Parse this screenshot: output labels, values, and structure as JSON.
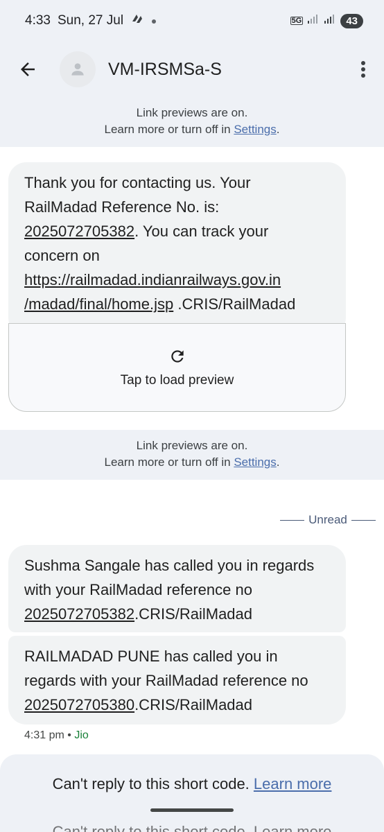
{
  "status_bar": {
    "time": "4:33",
    "date": "Sun, 27 Jul",
    "network": "5G",
    "battery": "43"
  },
  "header": {
    "contact_name": "VM-IRSMSa-S"
  },
  "link_notice": {
    "line1": "Link previews are on.",
    "line2_prefix": "Learn more or turn off in ",
    "settings_link": "Settings",
    "line2_suffix": "."
  },
  "messages": [
    {
      "text_1": "Thank you for contacting us. Your",
      "text_2": "RailMadad Reference No. is:",
      "ref_no": "2025072705382",
      "text_3": ". You can track your",
      "text_4": "concern on",
      "url_1": "https://railmadad.indianrailways.gov.in",
      "url_2": "/madad/final/home.jsp",
      "text_5": " .CRIS/RailMadad"
    },
    {
      "text_1": "Sushma Sangale has called you in regards",
      "text_2": "with your RailMadad reference no",
      "ref_no": "2025072705382",
      "text_3": ".CRIS/RailMadad"
    },
    {
      "text_1": "RAILMADAD  PUNE has called you in",
      "text_2": "regards with your RailMadad reference no",
      "ref_no": "2025072705380",
      "text_3": ".CRIS/RailMadad"
    }
  ],
  "preview": {
    "label": "Tap to load preview",
    "icon": "refresh-icon"
  },
  "divider": {
    "label": "Unread"
  },
  "meta": {
    "time": "4:31 pm",
    "separator": " • ",
    "carrier": "Jio"
  },
  "bottom": {
    "reply_text": "Can't reply to this short code. ",
    "learn_more": "Learn more",
    "cutoff_text": "Can't reply to this short code. Learn more"
  },
  "colors": {
    "accent_link": "#4a6dab",
    "carrier_green": "#188038",
    "header_bg": "#eef1f6",
    "bubble_bg": "#f1f3f4"
  }
}
